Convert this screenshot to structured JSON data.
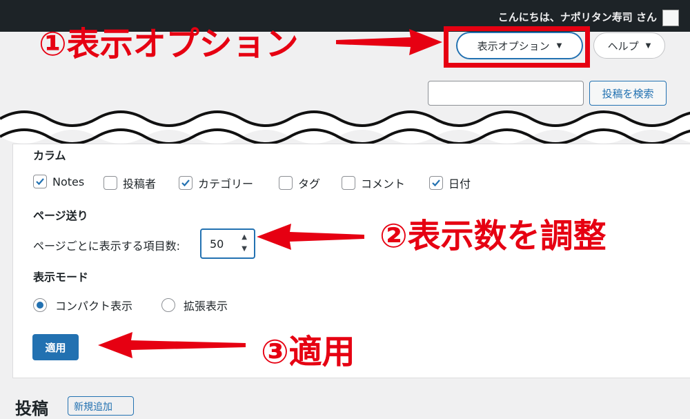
{
  "adminbar": {
    "greeting": "こんにちは、ナポリタン寿司 さん"
  },
  "screen_tabs": {
    "options_label": "表示オプション",
    "help_label": "ヘルプ"
  },
  "search": {
    "button_label": "投稿を検索",
    "placeholder": ""
  },
  "panel": {
    "columns_heading": "カラム",
    "columns": [
      {
        "label": "Notes",
        "checked": true
      },
      {
        "label": "投稿者",
        "checked": false
      },
      {
        "label": "カテゴリー",
        "checked": true
      },
      {
        "label": "タグ",
        "checked": false
      },
      {
        "label": "コメント",
        "checked": false
      },
      {
        "label": "日付",
        "checked": true
      }
    ],
    "pagination_heading": "ページ送り",
    "per_page_label": "ページごとに表示する項目数:",
    "per_page_value": "50",
    "view_mode_heading": "表示モード",
    "view_modes": [
      {
        "label": "コンパクト表示",
        "selected": true
      },
      {
        "label": "拡張表示",
        "selected": false
      }
    ],
    "apply_label": "適用"
  },
  "annotations": {
    "step1": "①表示オプション",
    "step2": "②表示数を調整",
    "step3": "③適用"
  },
  "page": {
    "title": "投稿",
    "add_new_label": "新規追加"
  },
  "colors": {
    "accent": "#2271b1",
    "annotation_red": "#e60012",
    "adminbar": "#1d2327"
  }
}
